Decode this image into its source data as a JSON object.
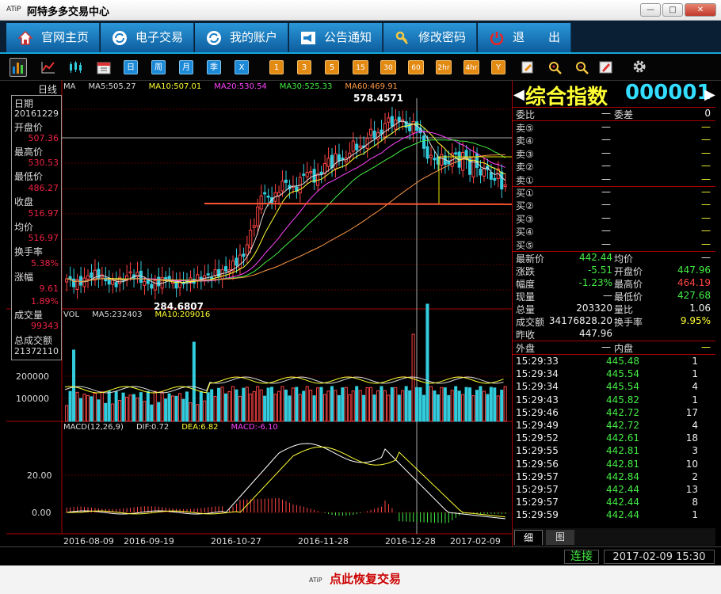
{
  "window": {
    "logo": "ATiP",
    "title": "阿特多多交易中心",
    "min_label": "—",
    "max_label": "□",
    "close_label": "✕"
  },
  "menu": [
    {
      "label": "官网主页",
      "icon": "home-icon"
    },
    {
      "label": "电子交易",
      "icon": "refresh-icon"
    },
    {
      "label": "我的账户",
      "icon": "refresh-icon"
    },
    {
      "label": "公告通知",
      "icon": "megaphone-icon"
    },
    {
      "label": "修改密码",
      "icon": "key-icon"
    },
    {
      "label": "退　　出",
      "icon": "power-icon"
    }
  ],
  "toolbar": {
    "period_buttons": [
      "日",
      "周",
      "月",
      "季",
      "X"
    ],
    "minute_buttons": [
      "1",
      "3",
      "5",
      "15",
      "30",
      "60",
      "2hr",
      "4hr",
      "Y"
    ]
  },
  "chart": {
    "period_label": "日线",
    "ma_labels": [
      {
        "text": "MA",
        "color": "#dddddd"
      },
      {
        "text": "MA5:505.27",
        "color": "#dddddd"
      },
      {
        "text": "MA10:507.01",
        "color": "#ffff33"
      },
      {
        "text": "MA20:530.54",
        "color": "#ff44ff"
      },
      {
        "text": "MA30:525.33",
        "color": "#44ee44"
      },
      {
        "text": "MA60:469.91",
        "color": "#ff9944"
      }
    ],
    "price_ticks": [],
    "high_marker": "578.4571",
    "low_marker": "284.6807",
    "vol_labels": [
      {
        "text": "VOL",
        "color": "#dddddd"
      },
      {
        "text": "MA5:232403",
        "color": "#dddddd"
      },
      {
        "text": "MA10:209016",
        "color": "#ffff33"
      }
    ],
    "vol_ticks": [
      "200000",
      "100000"
    ],
    "macd_labels": [
      {
        "text": "MACD(12,26,9)",
        "color": "#dddddd"
      },
      {
        "text": "DIF:0.72",
        "color": "#dddddd"
      },
      {
        "text": "DEA:6.82",
        "color": "#ffff33"
      },
      {
        "text": "MACD:-6.10",
        "color": "#ff44ff"
      }
    ],
    "macd_ticks": [
      "20.00",
      "0.00"
    ],
    "dates": [
      "2016-08-09",
      "2016-09-19",
      "2016-10-27",
      "2016-11-28",
      "2016-12-28",
      "2017-02-09"
    ]
  },
  "info_box": {
    "rows": [
      {
        "label": "日期",
        "value": "20161229",
        "color": "white"
      },
      {
        "label": "开盘价",
        "value": "507.36",
        "color": "red"
      },
      {
        "label": "最高价",
        "value": "530.53",
        "color": "red"
      },
      {
        "label": "最低价",
        "value": "486.27",
        "color": "red"
      },
      {
        "label": "收盘",
        "value": "516.97",
        "color": "red"
      },
      {
        "label": "均价",
        "value": "516.97",
        "color": "red"
      },
      {
        "label": "换手率",
        "value": "5.38%",
        "color": "red"
      },
      {
        "label": "涨幅",
        "value": "9.61",
        "color": "red",
        "value2": "1.89%"
      },
      {
        "label": "成交量",
        "value": "99343",
        "color": "red"
      },
      {
        "label": "总成交额",
        "value": "21372110",
        "color": "white"
      }
    ]
  },
  "quote": {
    "name": "综合指数",
    "code": "000001",
    "weibi_label": "委比",
    "weibi_value": "—",
    "weicha_label": "委差",
    "weicha_value": "0",
    "sells": [
      {
        "label": "卖⑤",
        "price": "—",
        "vol": "—"
      },
      {
        "label": "卖④",
        "price": "—",
        "vol": "—"
      },
      {
        "label": "卖③",
        "price": "—",
        "vol": "—"
      },
      {
        "label": "卖②",
        "price": "—",
        "vol": "—"
      },
      {
        "label": "卖①",
        "price": "—",
        "vol": "—"
      }
    ],
    "buys": [
      {
        "label": "买①",
        "price": "—",
        "vol": "—"
      },
      {
        "label": "买②",
        "price": "—",
        "vol": "—"
      },
      {
        "label": "买③",
        "price": "—",
        "vol": "—"
      },
      {
        "label": "买④",
        "price": "—",
        "vol": "—"
      },
      {
        "label": "买⑤",
        "price": "—",
        "vol": "—"
      }
    ],
    "stats": [
      [
        {
          "l": "最新价",
          "v": "442.44",
          "c": "green"
        },
        {
          "l": "均价",
          "v": "—",
          "c": "white"
        }
      ],
      [
        {
          "l": "涨跌",
          "v": "-5.51",
          "c": "green"
        },
        {
          "l": "开盘价",
          "v": "447.96",
          "c": "green"
        }
      ],
      [
        {
          "l": "幅度",
          "v": "-1.23%",
          "c": "green"
        },
        {
          "l": "最高价",
          "v": "464.19",
          "c": "red"
        }
      ],
      [
        {
          "l": "现量",
          "v": "—",
          "c": "white"
        },
        {
          "l": "最低价",
          "v": "427.68",
          "c": "green"
        }
      ],
      [
        {
          "l": "总量",
          "v": "203320",
          "c": "white"
        },
        {
          "l": "量比",
          "v": "1.06",
          "c": "white"
        }
      ],
      [
        {
          "l": "成交额",
          "v": "34176828.20",
          "c": "white"
        },
        {
          "l": "换手率",
          "v": "9.95%",
          "c": "yellow"
        }
      ],
      [
        {
          "l": "昨收",
          "v": "447.96",
          "c": "white"
        },
        {
          "l": "",
          "v": "",
          "c": "white"
        }
      ]
    ],
    "waipan_label": "外盘",
    "waipan_value": "—",
    "neipan_label": "内盘",
    "neipan_value": "—",
    "ticks": [
      {
        "time": "15:29:33",
        "price": "445.48",
        "vol": "1"
      },
      {
        "time": "15:29:34",
        "price": "445.54",
        "vol": "1"
      },
      {
        "time": "15:29:34",
        "price": "445.54",
        "vol": "4"
      },
      {
        "time": "15:29:43",
        "price": "445.82",
        "vol": "1"
      },
      {
        "time": "15:29:46",
        "price": "442.72",
        "vol": "17"
      },
      {
        "time": "15:29:49",
        "price": "442.72",
        "vol": "4"
      },
      {
        "time": "15:29:52",
        "price": "442.61",
        "vol": "18"
      },
      {
        "time": "15:29:55",
        "price": "442.81",
        "vol": "3"
      },
      {
        "time": "15:29:56",
        "price": "442.81",
        "vol": "10"
      },
      {
        "time": "15:29:57",
        "price": "442.84",
        "vol": "2"
      },
      {
        "time": "15:29:57",
        "price": "442.44",
        "vol": "13"
      },
      {
        "time": "15:29:57",
        "price": "442.44",
        "vol": "8"
      },
      {
        "time": "15:29:59",
        "price": "442.44",
        "vol": "1"
      }
    ],
    "tabs": [
      "细",
      "图"
    ]
  },
  "status": {
    "connection": "连接",
    "datetime": "2017-02-09 15:30"
  },
  "footer": {
    "logo": "ATiP",
    "text": "点此恢复交易"
  },
  "colors": {
    "up": "#ff4444",
    "down": "#33ccdd",
    "green": "#44ee44",
    "yellow": "#ffff33",
    "magenta": "#ff44ff",
    "orange": "#ff9944"
  }
}
